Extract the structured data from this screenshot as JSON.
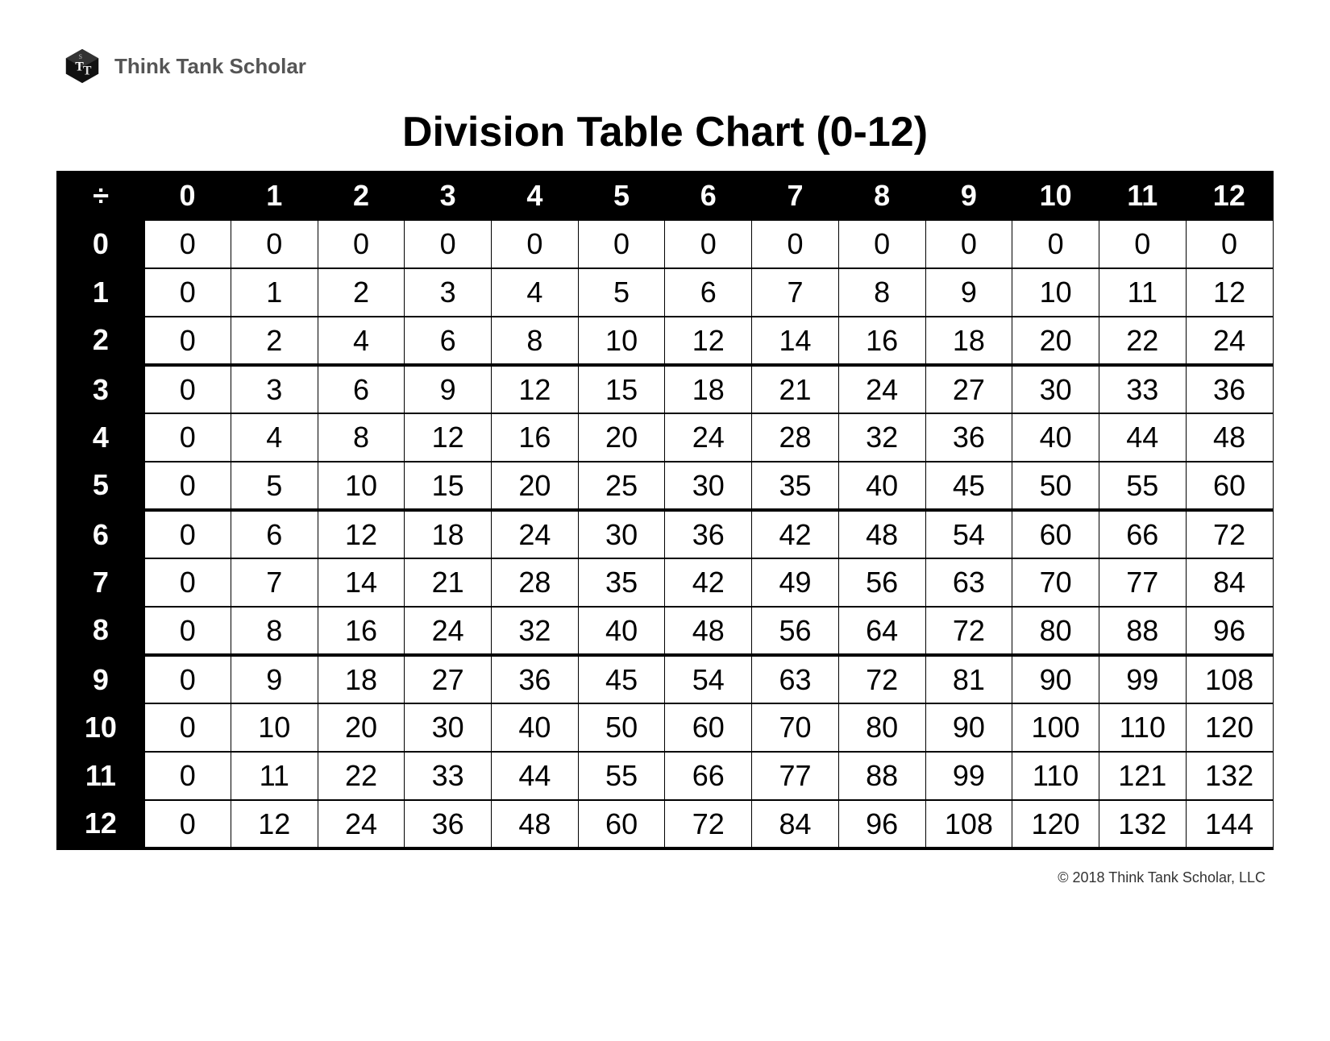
{
  "brand": "Think Tank Scholar",
  "title": "Division Table Chart (0-12)",
  "corner_symbol": "÷",
  "col_headers": [
    "0",
    "1",
    "2",
    "3",
    "4",
    "5",
    "6",
    "7",
    "8",
    "9",
    "10",
    "11",
    "12"
  ],
  "row_headers": [
    "0",
    "1",
    "2",
    "3",
    "4",
    "5",
    "6",
    "7",
    "8",
    "9",
    "10",
    "11",
    "12"
  ],
  "rows": [
    [
      "0",
      "0",
      "0",
      "0",
      "0",
      "0",
      "0",
      "0",
      "0",
      "0",
      "0",
      "0",
      "0"
    ],
    [
      "0",
      "1",
      "2",
      "3",
      "4",
      "5",
      "6",
      "7",
      "8",
      "9",
      "10",
      "11",
      "12"
    ],
    [
      "0",
      "2",
      "4",
      "6",
      "8",
      "10",
      "12",
      "14",
      "16",
      "18",
      "20",
      "22",
      "24"
    ],
    [
      "0",
      "3",
      "6",
      "9",
      "12",
      "15",
      "18",
      "21",
      "24",
      "27",
      "30",
      "33",
      "36"
    ],
    [
      "0",
      "4",
      "8",
      "12",
      "16",
      "20",
      "24",
      "28",
      "32",
      "36",
      "40",
      "44",
      "48"
    ],
    [
      "0",
      "5",
      "10",
      "15",
      "20",
      "25",
      "30",
      "35",
      "40",
      "45",
      "50",
      "55",
      "60"
    ],
    [
      "0",
      "6",
      "12",
      "18",
      "24",
      "30",
      "36",
      "42",
      "48",
      "54",
      "60",
      "66",
      "72"
    ],
    [
      "0",
      "7",
      "14",
      "21",
      "28",
      "35",
      "42",
      "49",
      "56",
      "63",
      "70",
      "77",
      "84"
    ],
    [
      "0",
      "8",
      "16",
      "24",
      "32",
      "40",
      "48",
      "56",
      "64",
      "72",
      "80",
      "88",
      "96"
    ],
    [
      "0",
      "9",
      "18",
      "27",
      "36",
      "45",
      "54",
      "63",
      "72",
      "81",
      "90",
      "99",
      "108"
    ],
    [
      "0",
      "10",
      "20",
      "30",
      "40",
      "50",
      "60",
      "70",
      "80",
      "90",
      "100",
      "110",
      "120"
    ],
    [
      "0",
      "11",
      "22",
      "33",
      "44",
      "55",
      "66",
      "77",
      "88",
      "99",
      "110",
      "121",
      "132"
    ],
    [
      "0",
      "12",
      "24",
      "36",
      "48",
      "60",
      "72",
      "84",
      "96",
      "108",
      "120",
      "132",
      "144"
    ]
  ],
  "copyright": "© 2018 Think Tank Scholar, LLC"
}
